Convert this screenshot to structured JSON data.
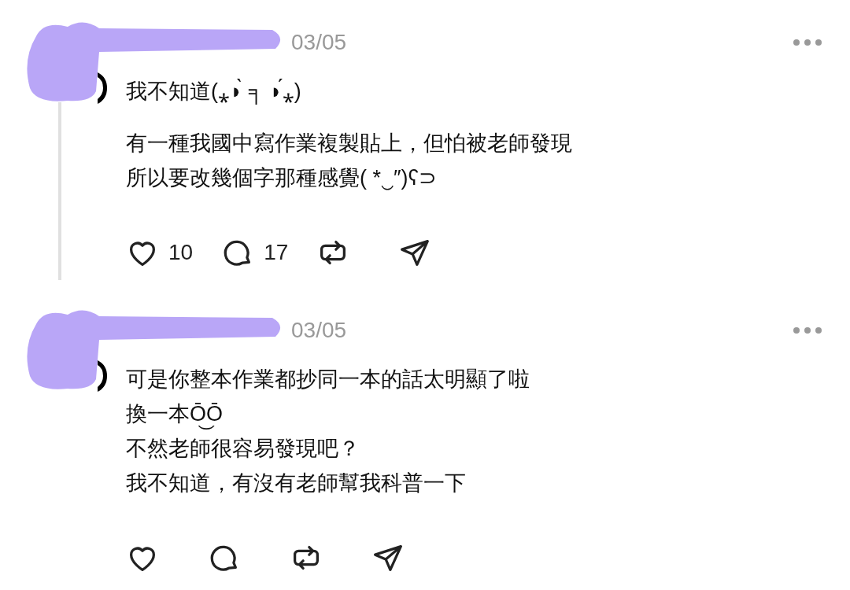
{
  "posts": [
    {
      "date": "03/05",
      "thread_line": true,
      "paragraphs": [
        [
          "我不知道(⁎◗̀ ╕ ◗́⁎)"
        ],
        [
          "有一種我國中寫作業複製貼上，但怕被老師發現",
          "所以要改幾個字那種感覺( *‿″)ʕ⊃"
        ]
      ],
      "actions": [
        {
          "kind": "like",
          "count": "10"
        },
        {
          "kind": "comment",
          "count": "17"
        },
        {
          "kind": "repost"
        },
        {
          "kind": "share"
        }
      ]
    },
    {
      "date": "03/05",
      "thread_line": false,
      "paragraphs": [
        [
          "可是你整本作業都抄同一本的話太明顯了啦",
          "換一本Ō͜Ō",
          "不然老師很容易發現吧？",
          "我不知道，有沒有老師幫我科普一下"
        ]
      ],
      "actions": [
        {
          "kind": "like"
        },
        {
          "kind": "comment"
        },
        {
          "kind": "repost"
        },
        {
          "kind": "share"
        }
      ]
    }
  ]
}
